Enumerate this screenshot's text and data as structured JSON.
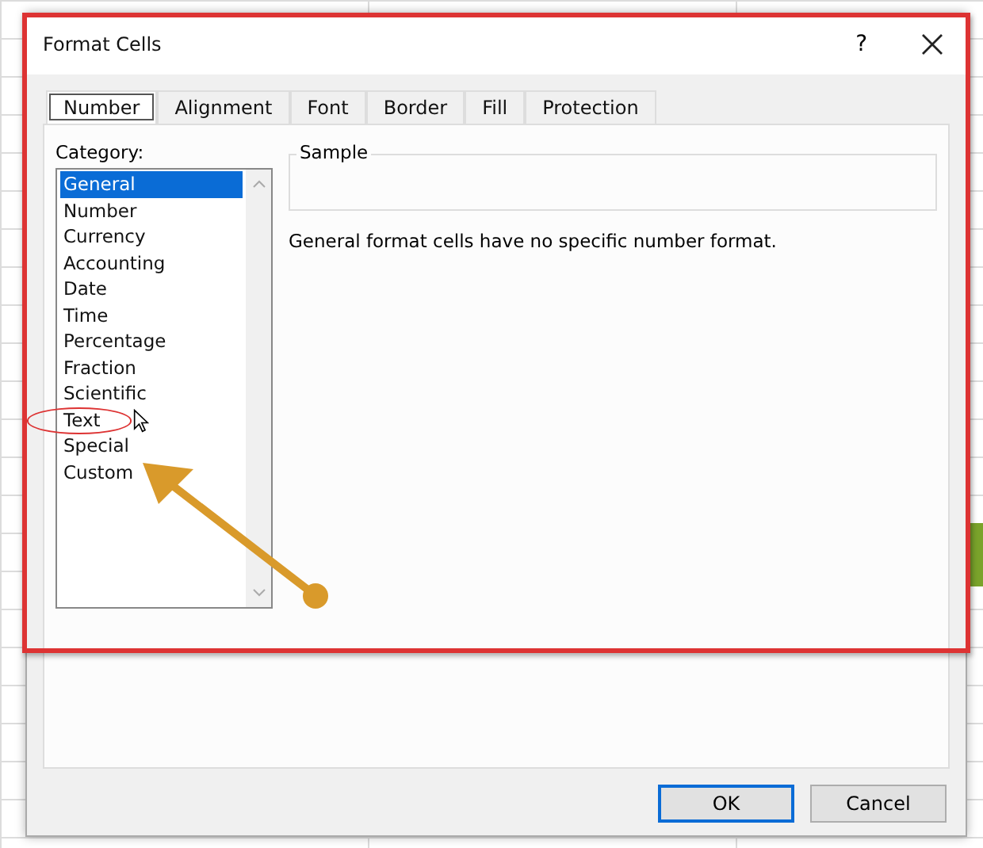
{
  "window": {
    "title": "Format Cells",
    "help": "?"
  },
  "tabs": [
    {
      "label": "Number",
      "selected": true
    },
    {
      "label": "Alignment",
      "selected": false
    },
    {
      "label": "Font",
      "selected": false
    },
    {
      "label": "Border",
      "selected": false
    },
    {
      "label": "Fill",
      "selected": false
    },
    {
      "label": "Protection",
      "selected": false
    }
  ],
  "category": {
    "label": "Category:",
    "items": [
      {
        "label": "General",
        "selected": true
      },
      {
        "label": "Number",
        "selected": false
      },
      {
        "label": "Currency",
        "selected": false
      },
      {
        "label": "Accounting",
        "selected": false
      },
      {
        "label": "Date",
        "selected": false
      },
      {
        "label": "Time",
        "selected": false
      },
      {
        "label": "Percentage",
        "selected": false
      },
      {
        "label": "Fraction",
        "selected": false
      },
      {
        "label": "Scientific",
        "selected": false
      },
      {
        "label": "Text",
        "selected": false
      },
      {
        "label": "Special",
        "selected": false
      },
      {
        "label": "Custom",
        "selected": false
      }
    ]
  },
  "sample": {
    "label": "Sample"
  },
  "description": "General format cells have no specific number format.",
  "buttons": [
    {
      "label": "OK",
      "default": true
    },
    {
      "label": "Cancel",
      "default": false
    }
  ]
}
